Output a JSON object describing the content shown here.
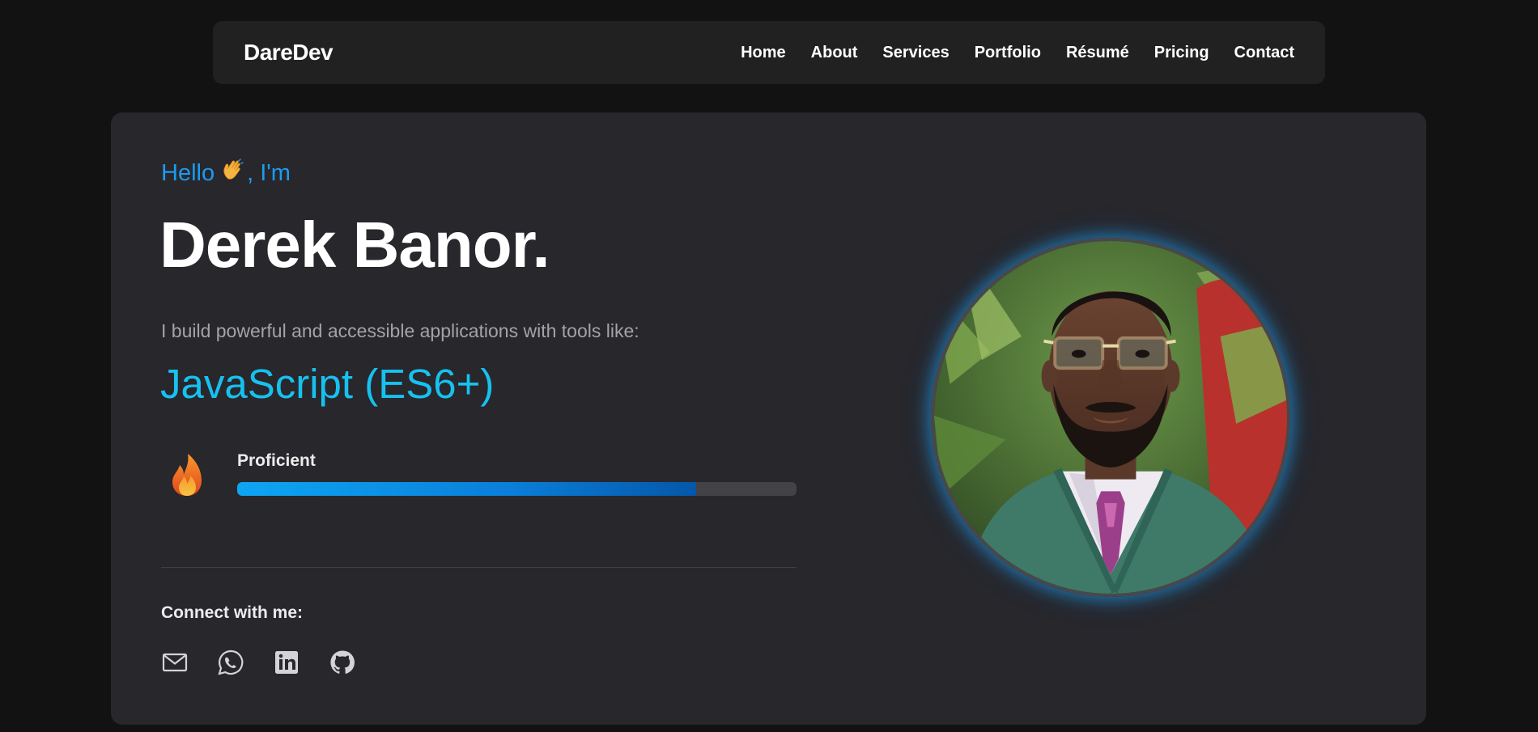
{
  "nav": {
    "brand": "DareDev",
    "links": [
      "Home",
      "About",
      "Services",
      "Portfolio",
      "Résumé",
      "Pricing",
      "Contact"
    ]
  },
  "hero": {
    "greeting_prefix": "Hello",
    "greeting_suffix": ", I'm",
    "name": "Derek Banor.",
    "tagline": "I build powerful and accessible applications with tools like:",
    "current_tool": "JavaScript (ES6+)",
    "skill_level": "Proficient",
    "skill_progress_percent": 82,
    "connect_label": "Connect with me:",
    "socials": [
      "email-icon",
      "whatsapp-icon",
      "linkedin-icon",
      "github-icon"
    ]
  },
  "colors": {
    "accent_blue": "#1d9bf0",
    "tool_cyan": "#17c1ef",
    "page_bg": "#121212",
    "card_bg": "#27272c",
    "nav_bg": "#212121"
  }
}
